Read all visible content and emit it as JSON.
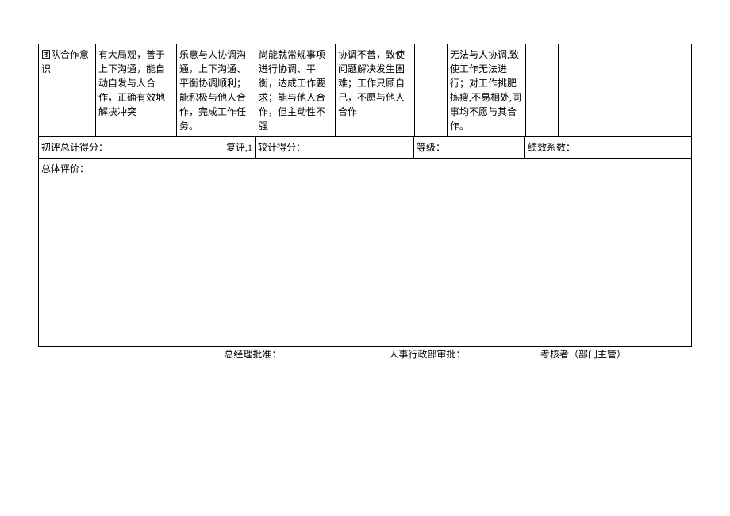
{
  "ratingRow": {
    "label": "团队合作意识",
    "level1": "有大局观，善于上下沟通，能自动自发与人合作，正确有效地解决冲突",
    "level2": "乐意与人协调沟通，上下沟通、平衡协调顺利；能积极与他人合作，完成工作任务。",
    "level3": "尚能就常规事项进行协调、平衡，达成工作要求；能与他人合作，但主动性不强",
    "level4": "协调不善，致使问题解决发生困难；工作只顾自己，不愿与他人合作",
    "blank1": "",
    "level5": "无法与人协调,致使工作无法进行；对工作挑肥拣瘦,不易相处,同事均不愿与其合作。",
    "blank2": "",
    "blank3": ""
  },
  "scoreRow": {
    "s1_label": "初评总计得分：",
    "s1_suffix": "复评,1",
    "s2_label": "较计得分：",
    "s3_label": "等级：",
    "s4_label": "绩效系数："
  },
  "commentRow": {
    "label": "总体评价："
  },
  "signatures": {
    "gm": "总经理批准：",
    "hr": "人事行政部审批：",
    "supervisor": "考核者（部门主管）"
  }
}
